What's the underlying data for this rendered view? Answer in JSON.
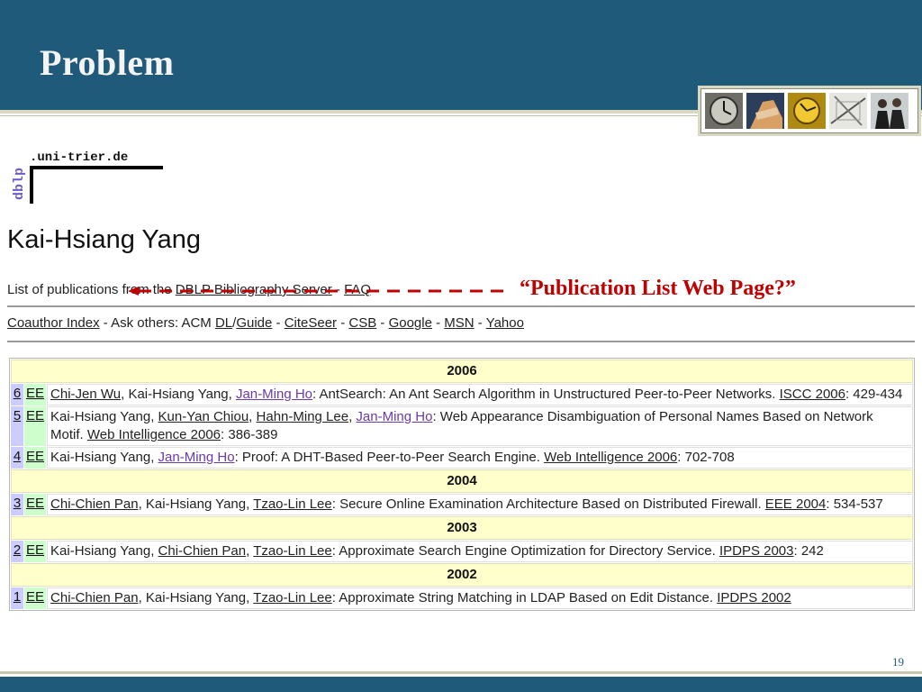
{
  "slide": {
    "title": "Problem",
    "page_number": "19",
    "colors": {
      "header": "#1f5a7a",
      "annotation": "#c00000",
      "year_row": "#ffffcc",
      "num_cell": "#ccccff",
      "ee_cell": "#ccffcc"
    }
  },
  "dblp": {
    "logo_vertical": "dblp",
    "logo_domain": ".uni-trier.de"
  },
  "author": {
    "name": "Kai-Hsiang Yang"
  },
  "pubs_line": {
    "prefix": "List of publications from the ",
    "server_link": "DBLP Bibliography Server",
    "sep": " - ",
    "faq_link": "FAQ"
  },
  "annotation": {
    "text": "“Publication List Web Page?”"
  },
  "coauth": {
    "index_link": "Coauthor Index",
    "ask": " - Ask others: ACM ",
    "dl": "DL",
    "slash": "/",
    "guide": "Guide",
    "d1": " - ",
    "citeseer": "CiteSeer",
    "d2": " - ",
    "csb": "CSB",
    "d3": " - ",
    "google": "Google",
    "d4": " - ",
    "msn": "MSN",
    "d5": " - ",
    "yahoo": "Yahoo"
  },
  "ee_label": "EE",
  "years": [
    "2006",
    "2004",
    "2003",
    "2002"
  ],
  "entries": [
    {
      "num": "6",
      "a1": "Chi-Jen Wu",
      "s1": ", Kai-Hsiang Yang, ",
      "a2": "Jan-Ming Ho",
      "text": ": AntSearch: An Ant Search Algorithm in Unstructured Peer-to-Peer Networks. ",
      "venue": "ISCC 2006",
      "pages": ": 429-434"
    },
    {
      "num": "5",
      "s0": "Kai-Hsiang Yang, ",
      "a1": "Kun-Yan Chiou",
      "s1": ", ",
      "a2": "Hahn-Ming Lee",
      "s2": ", ",
      "a3": "Jan-Ming Ho",
      "text": ": Web Appearance Disambiguation of Personal Names Based on Network Motif. ",
      "venue": "Web Intelligence 2006",
      "pages": ": 386-389"
    },
    {
      "num": "4",
      "s0": "Kai-Hsiang Yang, ",
      "a1": "Jan-Ming Ho",
      "text": ": Proof: A DHT-Based Peer-to-Peer Search Engine. ",
      "venue": "Web Intelligence 2006",
      "pages": ": 702-708"
    },
    {
      "num": "3",
      "a1": "Chi-Chien Pan",
      "s1": ", Kai-Hsiang Yang, ",
      "a2": "Tzao-Lin Lee",
      "text": ": Secure Online Examination Architecture Based on Distributed Firewall. ",
      "venue": "EEE 2004",
      "pages": ": 534-537"
    },
    {
      "num": "2",
      "s0": "Kai-Hsiang Yang, ",
      "a1": "Chi-Chien Pan",
      "s1": ", ",
      "a2": "Tzao-Lin Lee",
      "text": ": Approximate Search Engine Optimization for Directory Service. ",
      "venue": "IPDPS 2003",
      "pages": ": 242"
    },
    {
      "num": "1",
      "a1": "Chi-Chien Pan",
      "s1": ", Kai-Hsiang Yang, ",
      "a2": "Tzao-Lin Lee",
      "text": ": Approximate String Matching in LDAP Based on Edit Distance. ",
      "venue": "IPDPS 2002",
      "pages": ""
    }
  ]
}
